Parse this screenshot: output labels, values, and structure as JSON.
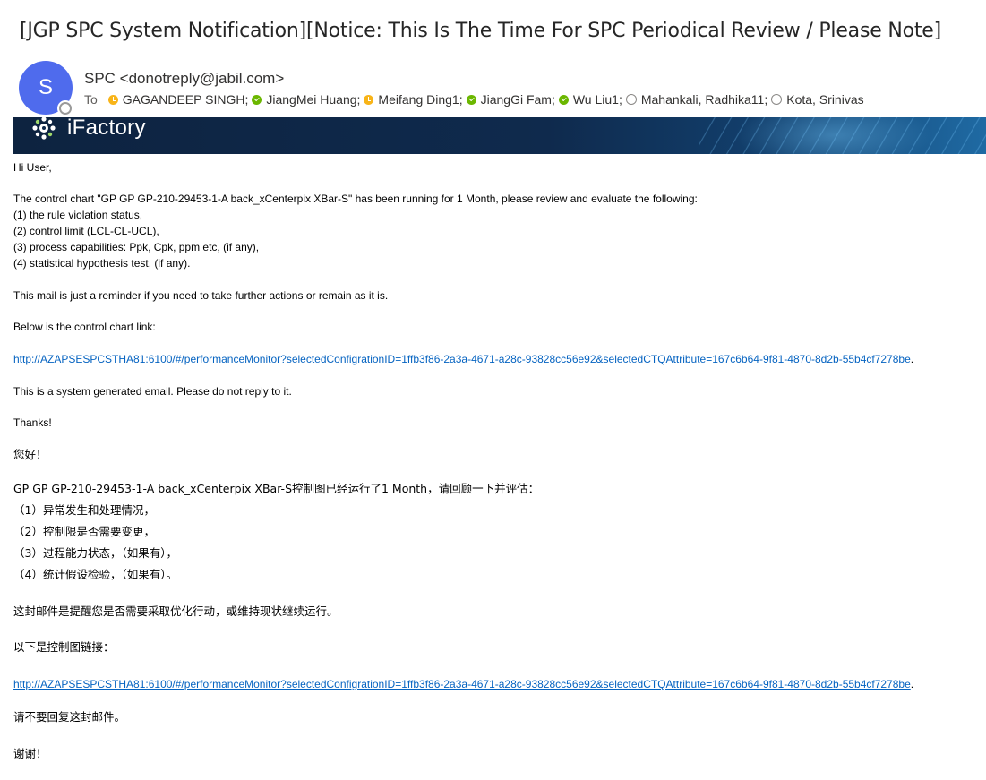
{
  "email": {
    "subject": "[JGP SPC System Notification][Notice: This Is The Time For SPC Periodical Review / Please Note]",
    "sender": {
      "initial": "S",
      "display": "SPC <donotreply@jabil.com>"
    },
    "to_label": "To",
    "recipients": [
      {
        "name": "GAGANDEEP SINGH;",
        "status": "away"
      },
      {
        "name": "JiangMei Huang;",
        "status": "available"
      },
      {
        "name": "Meifang Ding1;",
        "status": "away"
      },
      {
        "name": "JiangGi Fam;",
        "status": "available"
      },
      {
        "name": "Wu Liu1;",
        "status": "available"
      },
      {
        "name": "Mahankali, Radhika11;",
        "status": "offline"
      },
      {
        "name": "Kota, Srinivas",
        "status": "offline"
      }
    ],
    "banner": {
      "brand": "iFactory",
      "icon": "gear-network-icon"
    },
    "body_en": {
      "greeting": "Hi User,",
      "intro": "The control chart \"GP GP GP-210-29453-1-A back_xCenterpix XBar-S\" has been running for 1 Month, please review and evaluate the following:",
      "items": [
        "(1) the rule violation status,",
        "(2) control limit (LCL-CL-UCL),",
        "(3) process capabilities: Ppk, Cpk, ppm etc, (if any),",
        "(4) statistical hypothesis test, (if any)."
      ],
      "reminder": "This mail is just a reminder if you need to take further actions or remain as it is.",
      "link_intro": "Below is the control chart link:",
      "link": "http://AZAPSESPCSTHA81:6100/#/performanceMonitor?selectedConfigrationID=1ffb3f86-2a3a-4671-a28c-93828cc56e92&selectedCTQAttribute=167c6b64-9f81-4870-8d2b-55b4cf7278be",
      "link_suffix": ".",
      "system_note": "This is a system generated email. Please do not reply to it.",
      "thanks": "Thanks!"
    },
    "body_cn": {
      "greeting": "您好！",
      "intro": "GP GP GP-210-29453-1-A back_xCenterpix XBar-S控制图已经运行了1 Month，请回顾一下并评估：",
      "items": [
        "（1）异常发生和处理情况，",
        "（2）控制限是否需要变更，",
        "（3）过程能力状态，（如果有），",
        "（4）统计假设检验，（如果有）。"
      ],
      "reminder": "这封邮件是提醒您是否需要采取优化行动，或维持现状继续运行。",
      "link_intro": "以下是控制图链接：",
      "link": "http://AZAPSESPCSTHA81:6100/#/performanceMonitor?selectedConfigrationID=1ffb3f86-2a3a-4671-a28c-93828cc56e92&selectedCTQAttribute=167c6b64-9f81-4870-8d2b-55b4cf7278be",
      "link_suffix": ".",
      "system_note": "请不要回复这封邮件。",
      "thanks": "谢谢！"
    }
  }
}
